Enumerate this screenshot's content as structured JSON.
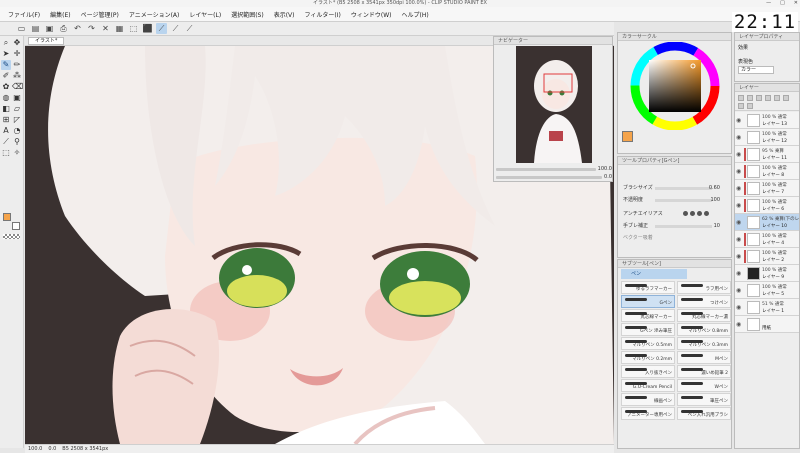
{
  "window": {
    "title": "イラスト* (B5 2508 x 3541px 350dpi 100.0%) - CLIP STUDIO PAINT EX",
    "controls": [
      "—",
      "□",
      "✕"
    ]
  },
  "clock": "22:11",
  "menu": [
    "ファイル(F)",
    "編集(E)",
    "ページ管理(P)",
    "アニメーション(A)",
    "レイヤー(L)",
    "選択範囲(S)",
    "表示(V)",
    "フィルター(I)",
    "ウィンドウ(W)",
    "ヘルプ(H)"
  ],
  "toolbar": {
    "icons": [
      "new-icon",
      "open-icon",
      "save-icon",
      "print-icon",
      "undo-icon",
      "redo-icon",
      "clear-icon",
      "fill-icon",
      "select-all-icon",
      "deselect-icon",
      "pen-mode-icon",
      "snap-icon",
      "ruler-icon"
    ],
    "glyphs": [
      "▭",
      "▤",
      "▣",
      "⎙",
      "↶",
      "↷",
      "✕",
      "▦",
      "⬚",
      "⬛",
      "⟋",
      "⟋",
      "⟋"
    ]
  },
  "document": {
    "tab_label": "イラスト*"
  },
  "statusbar": [
    "100.0",
    "0.0",
    "B5 2508 x 3541px"
  ],
  "navigator": {
    "title": "ナビゲーター",
    "zoom": "100.0",
    "angle": "0.0"
  },
  "colorwheel": {
    "title": "カラーサークル",
    "main_color": "#f5a44b"
  },
  "toolprop": {
    "title": "ツールプロパティ[Gペン]",
    "brush_size_label": "ブラシサイズ",
    "brush_size_value": "0.60",
    "opacity_label": "不透明度",
    "opacity_value": "100",
    "antialias_label": "アンチエイリアス",
    "stabilization_label": "手ブレ補正",
    "stabilization_value": "10",
    "vector_label": "ベクター吸着"
  },
  "subtool": {
    "title": "サブツール[ペン]",
    "active_tab": "ペン",
    "brushes": [
      {
        "name": "ゆるラフマーカー",
        "active": false
      },
      {
        "name": "ラフ用ペン",
        "active": false
      },
      {
        "name": "Gペン",
        "active": true
      },
      {
        "name": "つけペン",
        "active": false
      },
      {
        "name": "丸芯線マーカー",
        "active": false
      },
      {
        "name": "丸芯線マーカー濃",
        "active": false
      },
      {
        "name": "Gペン 滲み筆圧",
        "active": false
      },
      {
        "name": "マルりペン 0.8mm",
        "active": false
      },
      {
        "name": "マルりペン 0.5mm",
        "active": false
      },
      {
        "name": "マルりペン 0.3mm",
        "active": false
      },
      {
        "name": "マルりペン 0.2mm",
        "active": false
      },
      {
        "name": "Mペン",
        "active": false
      },
      {
        "name": "入り抜きペン",
        "active": false
      },
      {
        "name": "濃いめ鉛筆 2",
        "active": false
      },
      {
        "name": "G.U-Cream Pencil",
        "active": false
      },
      {
        "name": "Wペン",
        "active": false
      },
      {
        "name": "線画ペン",
        "active": false
      },
      {
        "name": "筆圧ペン",
        "active": false
      },
      {
        "name": "アニメーター専用ペン",
        "active": false
      },
      {
        "name": "ペン入れ汎用ブラシ",
        "active": false
      }
    ]
  },
  "layerprop": {
    "title": "レイヤープロパティ",
    "effect_label": "効果",
    "expression_label": "表現色",
    "expression_value": "カラー"
  },
  "layers": {
    "title": "レイヤー",
    "items": [
      {
        "meta": "100 % 通常",
        "name": "レイヤー 13",
        "thumb": "white",
        "active": false,
        "mark": false
      },
      {
        "meta": "100 % 通常",
        "name": "レイヤー 12",
        "thumb": "white",
        "active": false,
        "mark": false
      },
      {
        "meta": "95 % 乗算",
        "name": "レイヤー 11",
        "thumb": "white",
        "active": false,
        "mark": true
      },
      {
        "meta": "100 % 通常",
        "name": "レイヤー 8",
        "thumb": "white",
        "active": false,
        "mark": true
      },
      {
        "meta": "100 % 通常",
        "name": "レイヤー 7",
        "thumb": "white",
        "active": false,
        "mark": true
      },
      {
        "meta": "100 % 通常",
        "name": "レイヤー 6",
        "thumb": "white",
        "active": false,
        "mark": true
      },
      {
        "meta": "62 % 乗算(下のレ",
        "name": "レイヤー 10",
        "thumb": "white",
        "active": true,
        "mark": false
      },
      {
        "meta": "100 % 通常",
        "name": "レイヤー 4",
        "thumb": "white",
        "active": false,
        "mark": true
      },
      {
        "meta": "100 % 通常",
        "name": "レイヤー 2",
        "thumb": "white",
        "active": false,
        "mark": true
      },
      {
        "meta": "100 % 通常",
        "name": "レイヤー 9",
        "thumb": "black",
        "active": false,
        "mark": false
      },
      {
        "meta": "100 % 通常",
        "name": "レイヤー 5",
        "thumb": "white",
        "active": false,
        "mark": false
      },
      {
        "meta": "51 % 通常",
        "name": "レイヤー 1",
        "thumb": "white",
        "active": false,
        "mark": false
      },
      {
        "meta": "",
        "name": "用紙",
        "thumb": "white",
        "active": false,
        "mark": false
      }
    ]
  }
}
